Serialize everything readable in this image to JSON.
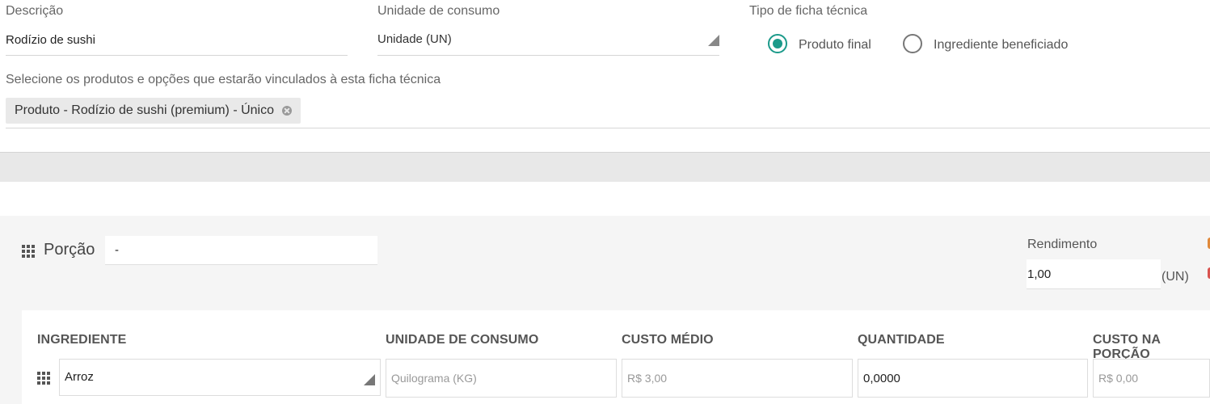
{
  "form": {
    "description": {
      "label": "Descrição",
      "value": "Rodízio de sushi"
    },
    "consumption_unit": {
      "label": "Unidade de consumo",
      "value": "Unidade (UN)"
    },
    "sheet_type": {
      "label": "Tipo de ficha técnica",
      "options": [
        {
          "label": "Produto final",
          "selected": true
        },
        {
          "label": "Ingrediente beneficiado",
          "selected": false
        }
      ]
    },
    "products": {
      "label": "Selecione os produtos e opções que estarão vinculados à esta ficha técnica",
      "chips": [
        "Produto - Rodízio de sushi (premium) - Único"
      ]
    }
  },
  "portion": {
    "title": "Porção",
    "name_value": "-",
    "yield": {
      "label": "Rendimento",
      "value": "1,00",
      "unit": "(UN)"
    }
  },
  "ingredients_table": {
    "headers": [
      "INGREDIENTE",
      "UNIDADE DE CONSUMO",
      "CUSTO MÉDIO",
      "QUANTIDADE",
      "CUSTO NA PORÇÃO"
    ],
    "rows": [
      {
        "ingredient": "Arroz",
        "unit": "Quilograma (KG)",
        "avg_cost": "R$ 3,00",
        "quantity": "0,0000",
        "portion_cost": "R$ 0,00"
      }
    ]
  },
  "colors": {
    "accent": "#1b9a8a",
    "edge_dot_top": "#e0893a",
    "edge_dot_bottom": "#d9534f"
  }
}
